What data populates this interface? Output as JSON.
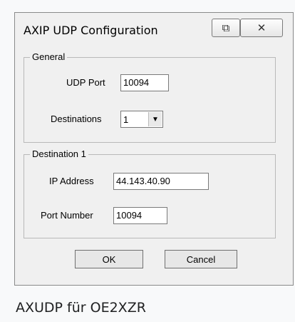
{
  "window": {
    "title": "AXIP UDP Configuration",
    "restore_glyph": "⧉",
    "close_glyph": "✕"
  },
  "general": {
    "group_label": "General",
    "udp_port_label": "UDP Port",
    "udp_port_value": "10094",
    "destinations_label": "Destinations",
    "destinations_value": "1",
    "destinations_arrow": "▼"
  },
  "destination1": {
    "group_label": "Destination 1",
    "ip_label": "IP Address",
    "ip_value": "44.143.40.90",
    "port_label": "Port Number",
    "port_value": "10094"
  },
  "buttons": {
    "ok_label": "OK",
    "cancel_label": "Cancel"
  },
  "caption": "AXUDP für OE2XZR",
  "icons": {
    "restore": "restore-icon",
    "close": "close-icon",
    "dropdown": "chevron-down-icon"
  }
}
